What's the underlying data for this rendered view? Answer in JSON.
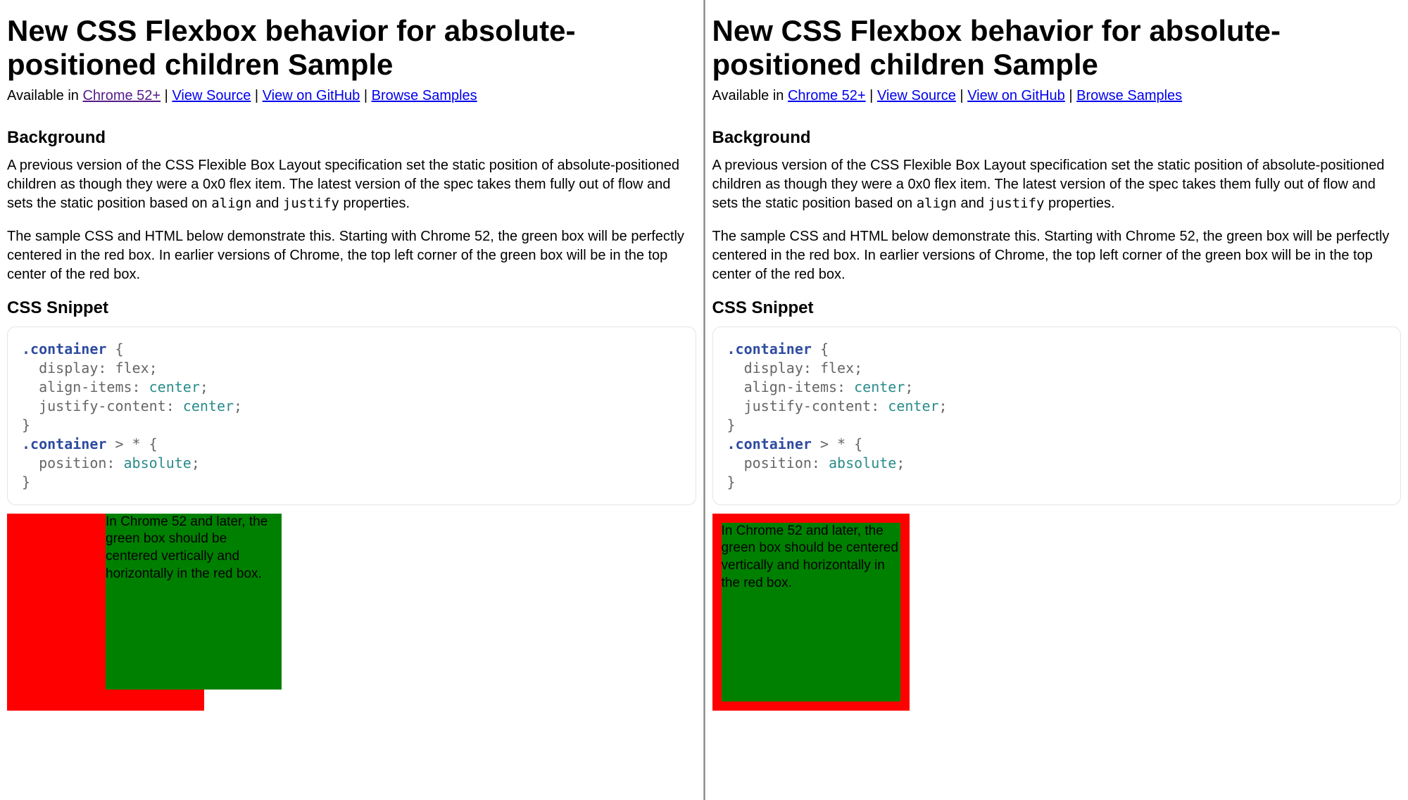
{
  "title": "New CSS Flexbox behavior for absolute-positioned children Sample",
  "meta": {
    "prefix": "Available in ",
    "chrome": "Chrome 52+",
    "viewSource": "View Source",
    "viewGithub": "View on GitHub",
    "browseSamples": "Browse Samples"
  },
  "headings": {
    "background": "Background",
    "cssSnippet": "CSS Snippet"
  },
  "paragraphs": {
    "bg1_a": "A previous version of the CSS Flexible Box Layout specification set the static position of absolute-positioned children as though they were a 0x0 flex item. The latest version of the spec takes them fully out of flow and sets the static position based on ",
    "bg1_code1": "align",
    "bg1_mid": " and ",
    "bg1_code2": "justify",
    "bg1_b": " properties.",
    "bg2": "The sample CSS and HTML below demonstrate this. Starting with Chrome 52, the green box will be perfectly centered in the red box. In earlier versions of Chrome, the top left corner of the green box will be in the top center of the red box."
  },
  "snippet": {
    "sel1": ".container",
    "brace1": " {",
    "l1": "  display: flex;",
    "l2a": "  align-items: ",
    "l2v": "center",
    "l2b": ";",
    "l3a": "  justify-content: ",
    "l3v": "center",
    "l3b": ";",
    "brace1c": "}",
    "sel2": ".container",
    "sel2b": " > * {",
    "l4a": "  position: ",
    "l4v": "absolute",
    "l4b": ";",
    "brace2c": "}"
  },
  "demoText": "In Chrome 52 and later, the green box should be centered vertically and horizontally in the red box."
}
